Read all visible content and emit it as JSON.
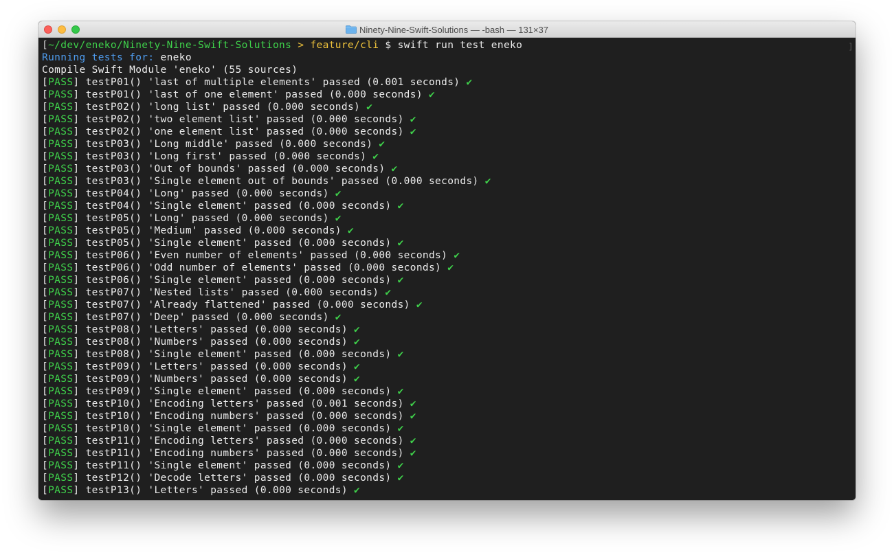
{
  "window": {
    "title": "Ninety-Nine-Swift-Solutions — -bash — 131×37",
    "folder_icon": "folder-icon"
  },
  "prompt": {
    "open_bracket": "[",
    "path": "~/dev/eneko/Ninety-Nine-Swift-Solutions",
    "separator": " > ",
    "branch": "feature/cli",
    "dollar": " $ ",
    "command": "swift run test eneko",
    "right_bracket": "]"
  },
  "running": {
    "label": "Running tests for:",
    "target": " eneko"
  },
  "compile_line": "Compile Swift Module 'eneko' (55 sources)",
  "pass_label": "PASS",
  "check_glyph": "✔",
  "results": [
    {
      "test": "testP01()",
      "rest": " 'last of multiple elements' passed (0.001 seconds) "
    },
    {
      "test": "testP01()",
      "rest": " 'last of one element' passed (0.000 seconds) "
    },
    {
      "test": "testP02()",
      "rest": " 'long list' passed (0.000 seconds) "
    },
    {
      "test": "testP02()",
      "rest": " 'two element list' passed (0.000 seconds) "
    },
    {
      "test": "testP02()",
      "rest": " 'one element list' passed (0.000 seconds) "
    },
    {
      "test": "testP03()",
      "rest": " 'Long middle' passed (0.000 seconds) "
    },
    {
      "test": "testP03()",
      "rest": " 'Long first' passed (0.000 seconds) "
    },
    {
      "test": "testP03()",
      "rest": " 'Out of bounds' passed (0.000 seconds) "
    },
    {
      "test": "testP03()",
      "rest": " 'Single element out of bounds' passed (0.000 seconds) "
    },
    {
      "test": "testP04()",
      "rest": " 'Long' passed (0.000 seconds) "
    },
    {
      "test": "testP04()",
      "rest": " 'Single element' passed (0.000 seconds) "
    },
    {
      "test": "testP05()",
      "rest": " 'Long' passed (0.000 seconds) "
    },
    {
      "test": "testP05()",
      "rest": " 'Medium' passed (0.000 seconds) "
    },
    {
      "test": "testP05()",
      "rest": " 'Single element' passed (0.000 seconds) "
    },
    {
      "test": "testP06()",
      "rest": " 'Even number of elements' passed (0.000 seconds) "
    },
    {
      "test": "testP06()",
      "rest": " 'Odd number of elements' passed (0.000 seconds) "
    },
    {
      "test": "testP06()",
      "rest": " 'Single element' passed (0.000 seconds) "
    },
    {
      "test": "testP07()",
      "rest": " 'Nested lists' passed (0.000 seconds) "
    },
    {
      "test": "testP07()",
      "rest": " 'Already flattened' passed (0.000 seconds) "
    },
    {
      "test": "testP07()",
      "rest": " 'Deep' passed (0.000 seconds) "
    },
    {
      "test": "testP08()",
      "rest": " 'Letters' passed (0.000 seconds) "
    },
    {
      "test": "testP08()",
      "rest": " 'Numbers' passed (0.000 seconds) "
    },
    {
      "test": "testP08()",
      "rest": " 'Single element' passed (0.000 seconds) "
    },
    {
      "test": "testP09()",
      "rest": " 'Letters' passed (0.000 seconds) "
    },
    {
      "test": "testP09()",
      "rest": " 'Numbers' passed (0.000 seconds) "
    },
    {
      "test": "testP09()",
      "rest": " 'Single element' passed (0.000 seconds) "
    },
    {
      "test": "testP10()",
      "rest": " 'Encoding letters' passed (0.001 seconds) "
    },
    {
      "test": "testP10()",
      "rest": " 'Encoding numbers' passed (0.000 seconds) "
    },
    {
      "test": "testP10()",
      "rest": " 'Single element' passed (0.000 seconds) "
    },
    {
      "test": "testP11()",
      "rest": " 'Encoding letters' passed (0.000 seconds) "
    },
    {
      "test": "testP11()",
      "rest": " 'Encoding numbers' passed (0.000 seconds) "
    },
    {
      "test": "testP11()",
      "rest": " 'Single element' passed (0.000 seconds) "
    },
    {
      "test": "testP12()",
      "rest": " 'Decode letters' passed (0.000 seconds) "
    },
    {
      "test": "testP13()",
      "rest": " 'Letters' passed (0.000 seconds) "
    }
  ],
  "colors": {
    "terminal_bg": "#1f1f1f",
    "path_green": "#3fd24b",
    "branch_yellow": "#f0c43c",
    "running_blue": "#4f9df0",
    "text": "#ececec"
  }
}
